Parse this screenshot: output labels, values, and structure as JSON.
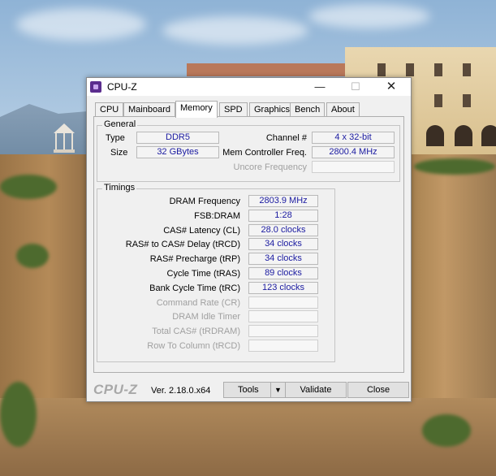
{
  "window": {
    "title": "CPU-Z",
    "controls": {
      "minimize": "—",
      "maximize": "☐",
      "close": "✕"
    }
  },
  "tabs": [
    {
      "label": "CPU",
      "active": false
    },
    {
      "label": "Mainboard",
      "active": false
    },
    {
      "label": "Memory",
      "active": true
    },
    {
      "label": "SPD",
      "active": false
    },
    {
      "label": "Graphics",
      "active": false
    },
    {
      "label": "Bench",
      "active": false
    },
    {
      "label": "About",
      "active": false
    }
  ],
  "general": {
    "title": "General",
    "type_label": "Type",
    "type_value": "DDR5",
    "size_label": "Size",
    "size_value": "32 GBytes",
    "channel_label": "Channel #",
    "channel_value": "4 x 32-bit",
    "mc_freq_label": "Mem Controller Freq.",
    "mc_freq_value": "2800.4 MHz",
    "uncore_label": "Uncore Frequency",
    "uncore_value": ""
  },
  "timings": {
    "title": "Timings",
    "rows": [
      {
        "label": "DRAM Frequency",
        "value": "2803.9 MHz",
        "enabled": true
      },
      {
        "label": "FSB:DRAM",
        "value": "1:28",
        "enabled": true
      },
      {
        "label": "CAS# Latency (CL)",
        "value": "28.0 clocks",
        "enabled": true
      },
      {
        "label": "RAS# to CAS# Delay (tRCD)",
        "value": "34 clocks",
        "enabled": true
      },
      {
        "label": "RAS# Precharge (tRP)",
        "value": "34 clocks",
        "enabled": true
      },
      {
        "label": "Cycle Time (tRAS)",
        "value": "89 clocks",
        "enabled": true
      },
      {
        "label": "Bank Cycle Time (tRC)",
        "value": "123 clocks",
        "enabled": true
      },
      {
        "label": "Command Rate (CR)",
        "value": "",
        "enabled": false
      },
      {
        "label": "DRAM Idle Timer",
        "value": "",
        "enabled": false
      },
      {
        "label": "Total CAS# (tRDRAM)",
        "value": "",
        "enabled": false
      },
      {
        "label": "Row To Column (tRCD)",
        "value": "",
        "enabled": false
      }
    ]
  },
  "footer": {
    "brand": "CPU-Z",
    "version": "Ver. 2.18.0.x64",
    "tools_label": "Tools",
    "tools_arrow": "▼",
    "validate_label": "Validate",
    "close_label": "Close"
  },
  "colors": {
    "value_text": "#1a1aa0",
    "disabled_text": "#a0a0a0",
    "app_icon": "#5b2d8e"
  }
}
